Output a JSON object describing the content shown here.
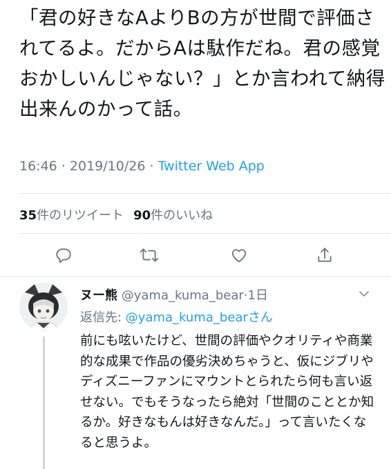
{
  "tweet": {
    "text": "「君の好きなAよりBの方が世間で評価されてるよ。だからAは駄作だね。君の感覚おかしいんじゃない？」とか言われて納得出来んのかって話。",
    "time": "16:46",
    "sep": "·",
    "date": "2019/10/26",
    "app": "Twitter Web App",
    "retweet_count": "35",
    "retweet_label": "件のリツイート",
    "like_count": "90",
    "like_label": "件のいいね"
  },
  "actions": {
    "reply_icon": "reply-icon",
    "retweet_icon": "retweet-icon",
    "like_icon": "heart-icon",
    "share_icon": "share-icon"
  },
  "reply": {
    "display_name": "ヌー熊",
    "handle": "@yama_kuma_bear",
    "sep": "·",
    "age": "1日",
    "reply_to_label": "返信先: ",
    "reply_to_handle": "@yama_kuma_bear",
    "reply_to_suffix": "さん",
    "text": "前にも呟いたけど、世間の評価やクオリティや商業的な成果で作品の優劣決めちゃうと、仮にジブリやディズニーファンにマウントとられたら何も言い返せない。でもそうなったら絶対「世間のこととか知るか。好きなもんは好きなんだ。」って言いたくなると思うよ。"
  },
  "colors": {
    "accent": "#1da1f2",
    "text": "#14171a",
    "muted": "#657786",
    "divider": "#e1e8ed"
  }
}
